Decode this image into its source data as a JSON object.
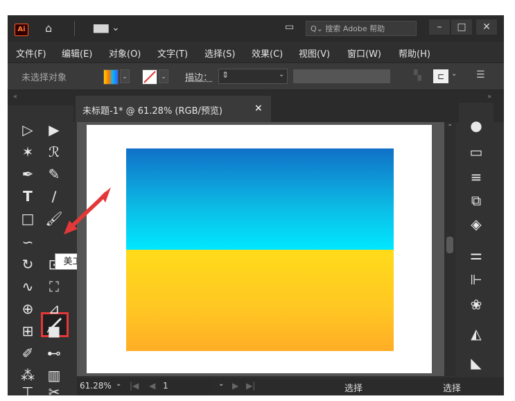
{
  "app": {
    "logo_text": "Ai",
    "search_placeholder": "搜索 Adobe 帮助"
  },
  "menu": [
    "文件(F)",
    "编辑(E)",
    "对象(O)",
    "文字(T)",
    "选择(S)",
    "效果(C)",
    "视图(V)",
    "窗口(W)",
    "帮助(H)"
  ],
  "control": {
    "no_selection": "未选择对象",
    "stroke_label": "描边："
  },
  "document": {
    "tab_title": "未标题-1* @ 61.28% (RGB/预览)",
    "close_symbol": "×"
  },
  "tooltip": "美工刀",
  "status": {
    "zoom": "61.28%",
    "page": "1",
    "mode_center": "选择",
    "mode_right": "选择"
  },
  "colors": {
    "annotation": "#e43838",
    "gradient_top_start": "#1070c7",
    "gradient_top_end": "#00e8ff",
    "gradient_bottom_start": "#ffdb1a",
    "gradient_bottom_end": "#ffad26"
  }
}
